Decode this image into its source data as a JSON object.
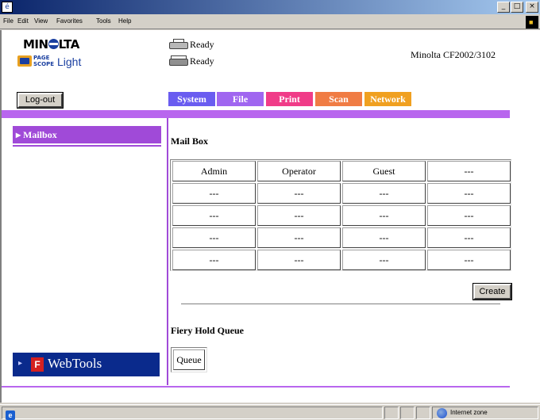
{
  "window": {
    "icon_glyph": "é",
    "controls": {
      "minimize": "_",
      "maximize": "□",
      "close": "×"
    }
  },
  "menubar": {
    "items": [
      "File",
      "Edit",
      "View",
      "Favorites",
      "Tools",
      "Help"
    ]
  },
  "header": {
    "brand": "MIN●LTA",
    "brand_prefix": "MIN",
    "brand_suffix": "LTA",
    "product_page": "PAGE",
    "product_scope": "SCOPE",
    "product_light": "Light",
    "status": [
      {
        "icon": "printer-icon",
        "text": "Ready"
      },
      {
        "icon": "copier-icon",
        "text": "Ready"
      }
    ],
    "model": "Minolta CF2002/3102"
  },
  "toolbar": {
    "logout_label": "Log-out",
    "tabs": [
      {
        "label": "System",
        "color": "#6a5cf0"
      },
      {
        "label": "File",
        "color": "#a066f0"
      },
      {
        "label": "Print",
        "color": "#f03c88"
      },
      {
        "label": "Scan",
        "color": "#f07c44"
      },
      {
        "label": "Network",
        "color": "#f0a020"
      }
    ]
  },
  "sidebar": {
    "items": [
      {
        "label": "▸ Mailbox",
        "active": true
      }
    ],
    "webtools": {
      "arrow": "▸",
      "logo_glyph": "F",
      "label": "WebTools"
    }
  },
  "main": {
    "mailbox": {
      "title": "Mail Box",
      "rows": [
        [
          "Admin",
          "Operator",
          "Guest",
          "---"
        ],
        [
          "---",
          "---",
          "---",
          "---"
        ],
        [
          "---",
          "---",
          "---",
          "---"
        ],
        [
          "---",
          "---",
          "---",
          "---"
        ],
        [
          "---",
          "---",
          "---",
          "---"
        ]
      ],
      "create_label": "Create"
    },
    "fiery": {
      "title": "Fiery Hold Queue",
      "queue_label": "Queue"
    }
  },
  "statusbar": {
    "zone": "Internet zone",
    "ie_glyph": "e"
  },
  "colors": {
    "accent_purple": "#b866ee",
    "sidebar_active": "#a04ad8",
    "webtools_bg": "#0a2a8c"
  }
}
